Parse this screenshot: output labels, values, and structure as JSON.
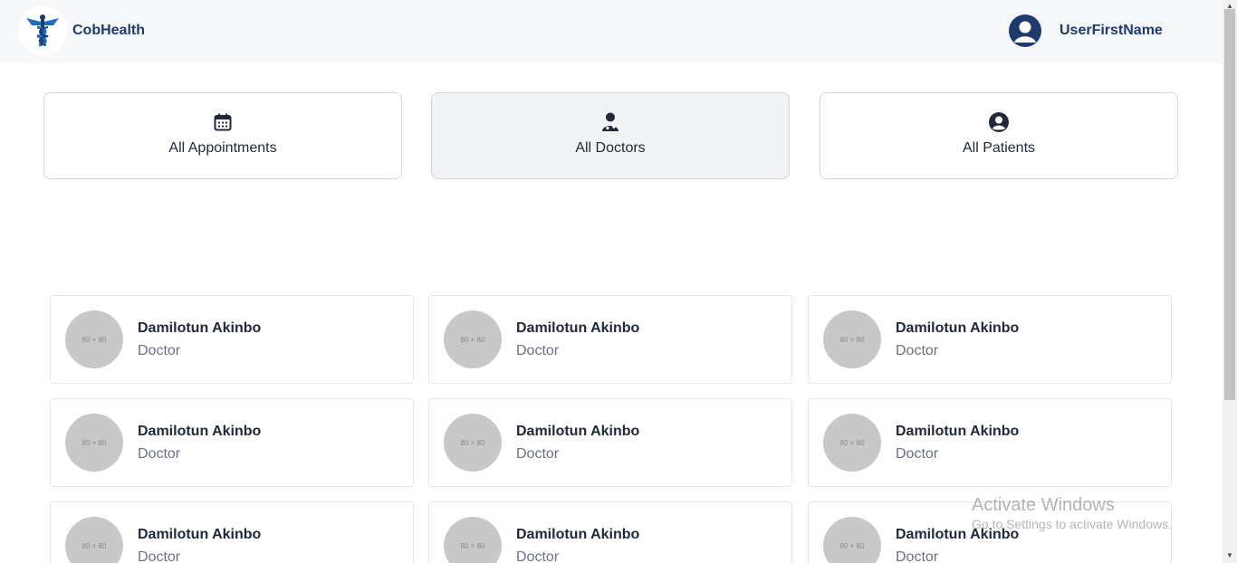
{
  "header": {
    "brand": "CobHealth",
    "username": "UserFirstName",
    "colors": {
      "brand": "#1e3a6e",
      "logo": "#1f6fbf"
    }
  },
  "nav": {
    "tiles": [
      {
        "label": "All Appointments",
        "icon": "calendar-icon"
      },
      {
        "label": "All Doctors",
        "icon": "doctor-icon",
        "active": true
      },
      {
        "label": "All Patients",
        "icon": "user-circle-icon"
      }
    ]
  },
  "doctors": [
    {
      "name": "Damilotun Akinbo",
      "role": "Doctor",
      "photo": "80 × 80"
    },
    {
      "name": "Damilotun Akinbo",
      "role": "Doctor",
      "photo": "80 × 80"
    },
    {
      "name": "Damilotun Akinbo",
      "role": "Doctor",
      "photo": "80 × 80"
    },
    {
      "name": "Damilotun Akinbo",
      "role": "Doctor",
      "photo": "80 × 80"
    },
    {
      "name": "Damilotun Akinbo",
      "role": "Doctor",
      "photo": "80 × 80"
    },
    {
      "name": "Damilotun Akinbo",
      "role": "Doctor",
      "photo": "80 × 80"
    },
    {
      "name": "Damilotun Akinbo",
      "role": "Doctor",
      "photo": "80 × 80"
    },
    {
      "name": "Damilotun Akinbo",
      "role": "Doctor",
      "photo": "80 × 80"
    },
    {
      "name": "Damilotun Akinbo",
      "role": "Doctor",
      "photo": "80 × 80"
    }
  ],
  "watermark": {
    "title": "Activate Windows",
    "subtitle": "Go to Settings to activate Windows."
  }
}
